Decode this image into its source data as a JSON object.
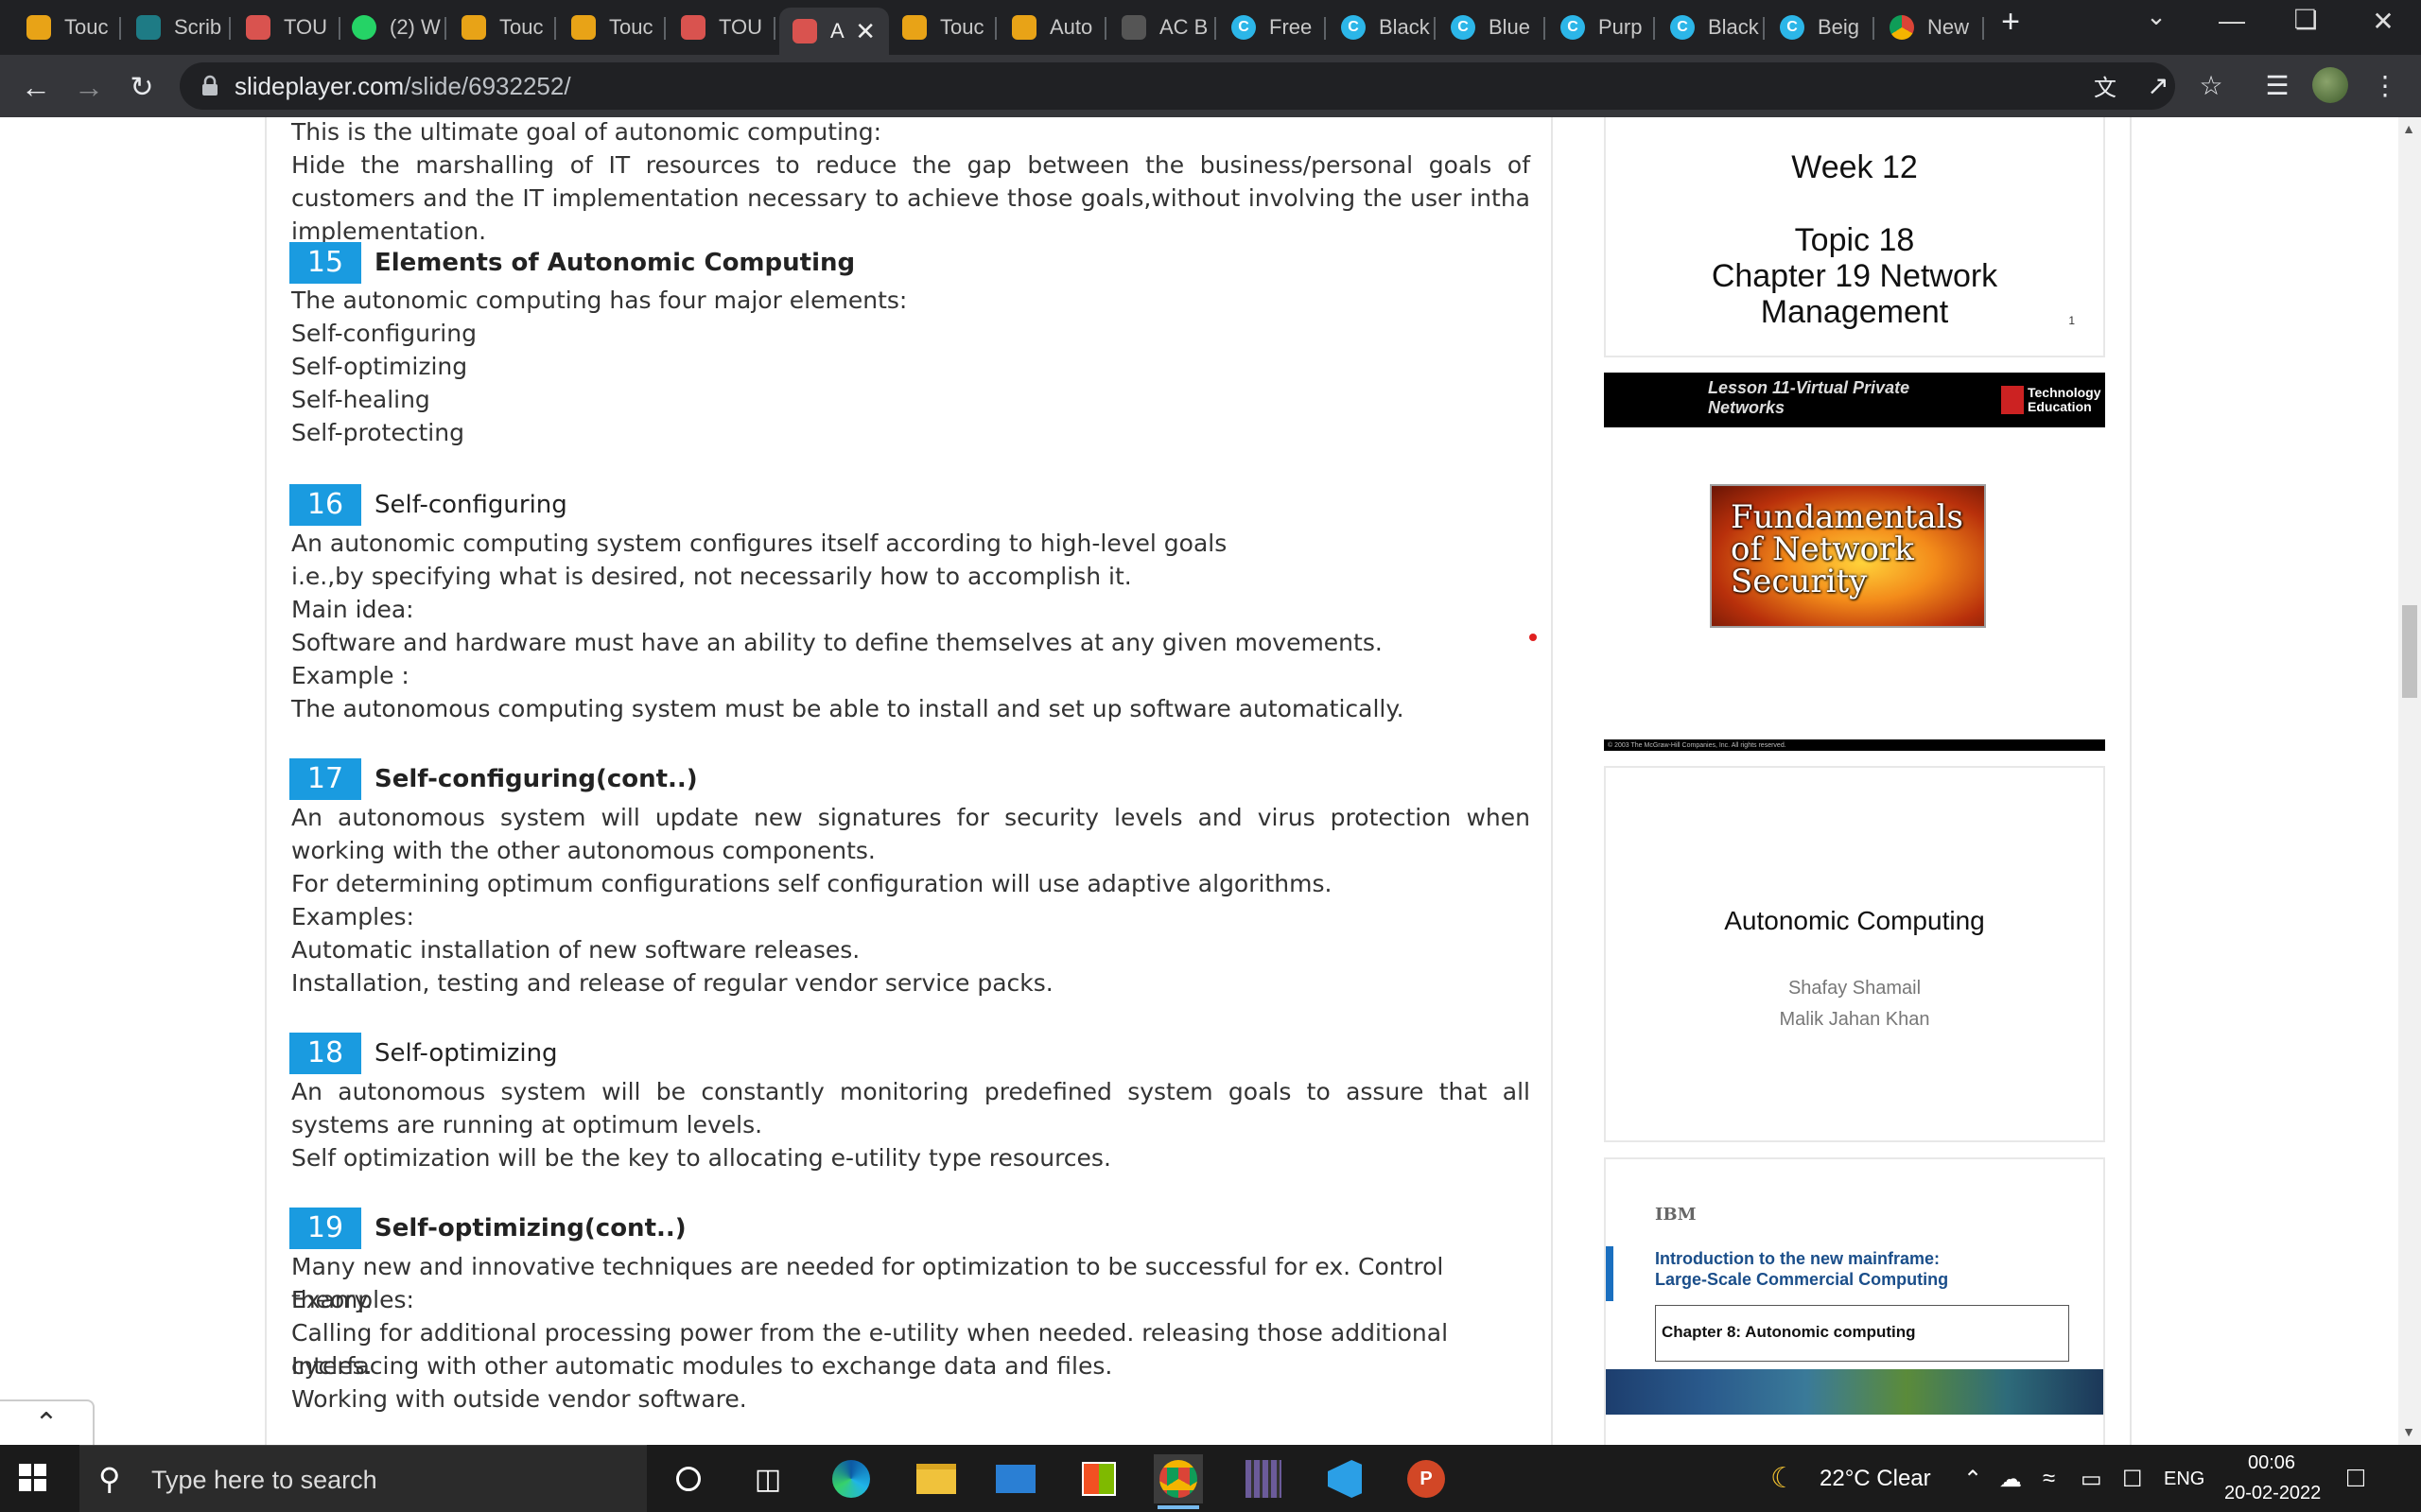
{
  "browser": {
    "tabs": [
      {
        "label": "Touc",
        "icon": "overleaf-icon",
        "color": "#e8a317"
      },
      {
        "label": "Scrib",
        "icon": "scribd-icon",
        "color": "#1e7b85"
      },
      {
        "label": "TOU",
        "icon": "slideplayer-icon",
        "color": "#d9534f"
      },
      {
        "label": "(2) W",
        "icon": "whatsapp-icon",
        "color": "#25d366"
      },
      {
        "label": "Touc",
        "icon": "overleaf-icon",
        "color": "#e8a317"
      },
      {
        "label": "Touc",
        "icon": "overleaf-icon",
        "color": "#e8a317"
      },
      {
        "label": "TOU",
        "icon": "slideplayer-icon",
        "color": "#d9534f"
      },
      {
        "label": "A",
        "icon": "slideplayer-icon",
        "color": "#d9534f",
        "active": true
      },
      {
        "label": "Touc",
        "icon": "overleaf-icon",
        "color": "#e8a317"
      },
      {
        "label": "Auto",
        "icon": "overleaf-icon",
        "color": "#e8a317"
      },
      {
        "label": "AC B",
        "icon": "ac-icon",
        "color": "#555"
      },
      {
        "label": "Free",
        "icon": "canva-icon",
        "color": "#00c4cc"
      },
      {
        "label": "Black",
        "icon": "canva-icon",
        "color": "#00c4cc"
      },
      {
        "label": "Blue",
        "icon": "canva-icon",
        "color": "#00c4cc"
      },
      {
        "label": "Purp",
        "icon": "canva-icon",
        "color": "#00c4cc"
      },
      {
        "label": "Black",
        "icon": "canva-icon",
        "color": "#00c4cc"
      },
      {
        "label": "Beig",
        "icon": "canva-icon",
        "color": "#00c4cc"
      },
      {
        "label": "New",
        "icon": "chrome-icon",
        "color": "#eee"
      }
    ],
    "url_host": "slideplayer.com",
    "url_path": "/slide/6932252/"
  },
  "content": {
    "intro_lines": [
      "This is the ultimate goal of autonomic computing:",
      "Hide the marshalling of IT resources to reduce the gap between the business/personal goals of customers and the IT implementation necessary to achieve those goals,without involving the user intha implementation."
    ],
    "slides": [
      {
        "num": "15",
        "title": "Elements of Autonomic Computing",
        "bold": true,
        "lines": [
          "The autonomic computing has four major elements:",
          "Self-configuring",
          "Self-optimizing",
          "Self-healing",
          "Self-protecting"
        ]
      },
      {
        "num": "16",
        "title": "Self-configuring",
        "bold": false,
        "lines": [
          "An autonomic computing system configures itself according to high-level goals",
          "i.e.,by specifying what is desired, not necessarily how to accomplish it.",
          "Main idea:",
          "Software and hardware must have an ability to define themselves at any given movements.",
          "Example :",
          "The autonomous computing system must be able to install and set up software automatically."
        ]
      },
      {
        "num": "17",
        "title": "Self-configuring(cont..)",
        "bold": true,
        "lines": [
          "An autonomous system will update new signatures for security levels and virus protection when working with the other autonomous components.",
          "For determining optimum configurations self configuration will use adaptive algorithms.",
          "Examples:",
          "Automatic installation of new software releases.",
          "Installation, testing and release of regular vendor service packs."
        ]
      },
      {
        "num": "18",
        "title": "Self-optimizing",
        "bold": false,
        "lines": [
          "An autonomous system will be constantly monitoring predefined system goals to assure that all systems are running at optimum levels.",
          "Self optimization will be the key to allocating e-utility type resources."
        ]
      },
      {
        "num": "19",
        "title": "Self-optimizing(cont..)",
        "bold": true,
        "lines": [
          "Many new and innovative techniques are needed for optimization to be successful for ex. Control theory.",
          "Examples:",
          "Calling for additional processing power from the e-utility when needed. releasing those additional cycles.",
          "Interfacing with other automatic modules to exchange data and files.",
          "Working with outside vendor software."
        ]
      }
    ]
  },
  "sidebar": {
    "thumb1": {
      "lines": [
        "Week 12",
        "Topic 18",
        "Chapter 19 Network",
        "Management"
      ],
      "page": "1"
    },
    "thumb2": {
      "lesson": "Lesson 11-Virtual Private Networks",
      "publisher": "Technology Education",
      "book_title": "Fundamentals of Network Security",
      "copyright": "© 2003 The McGraw-Hill Companies, Inc. All rights reserved."
    },
    "thumb3": {
      "title": "Autonomic Computing",
      "authors": [
        "Shafay Shamail",
        "Malik Jahan Khan"
      ]
    },
    "thumb4": {
      "brand": "IBM",
      "intro": "Introduction to the new mainframe:",
      "subtitle": "Large-Scale Commercial Computing",
      "chapter": "Chapter 8: Autonomic computing"
    }
  },
  "taskbar": {
    "search_placeholder": "Type here to search",
    "weather": "22°C  Clear",
    "language": "ENG",
    "time": "00:06",
    "date": "20-02-2022"
  }
}
